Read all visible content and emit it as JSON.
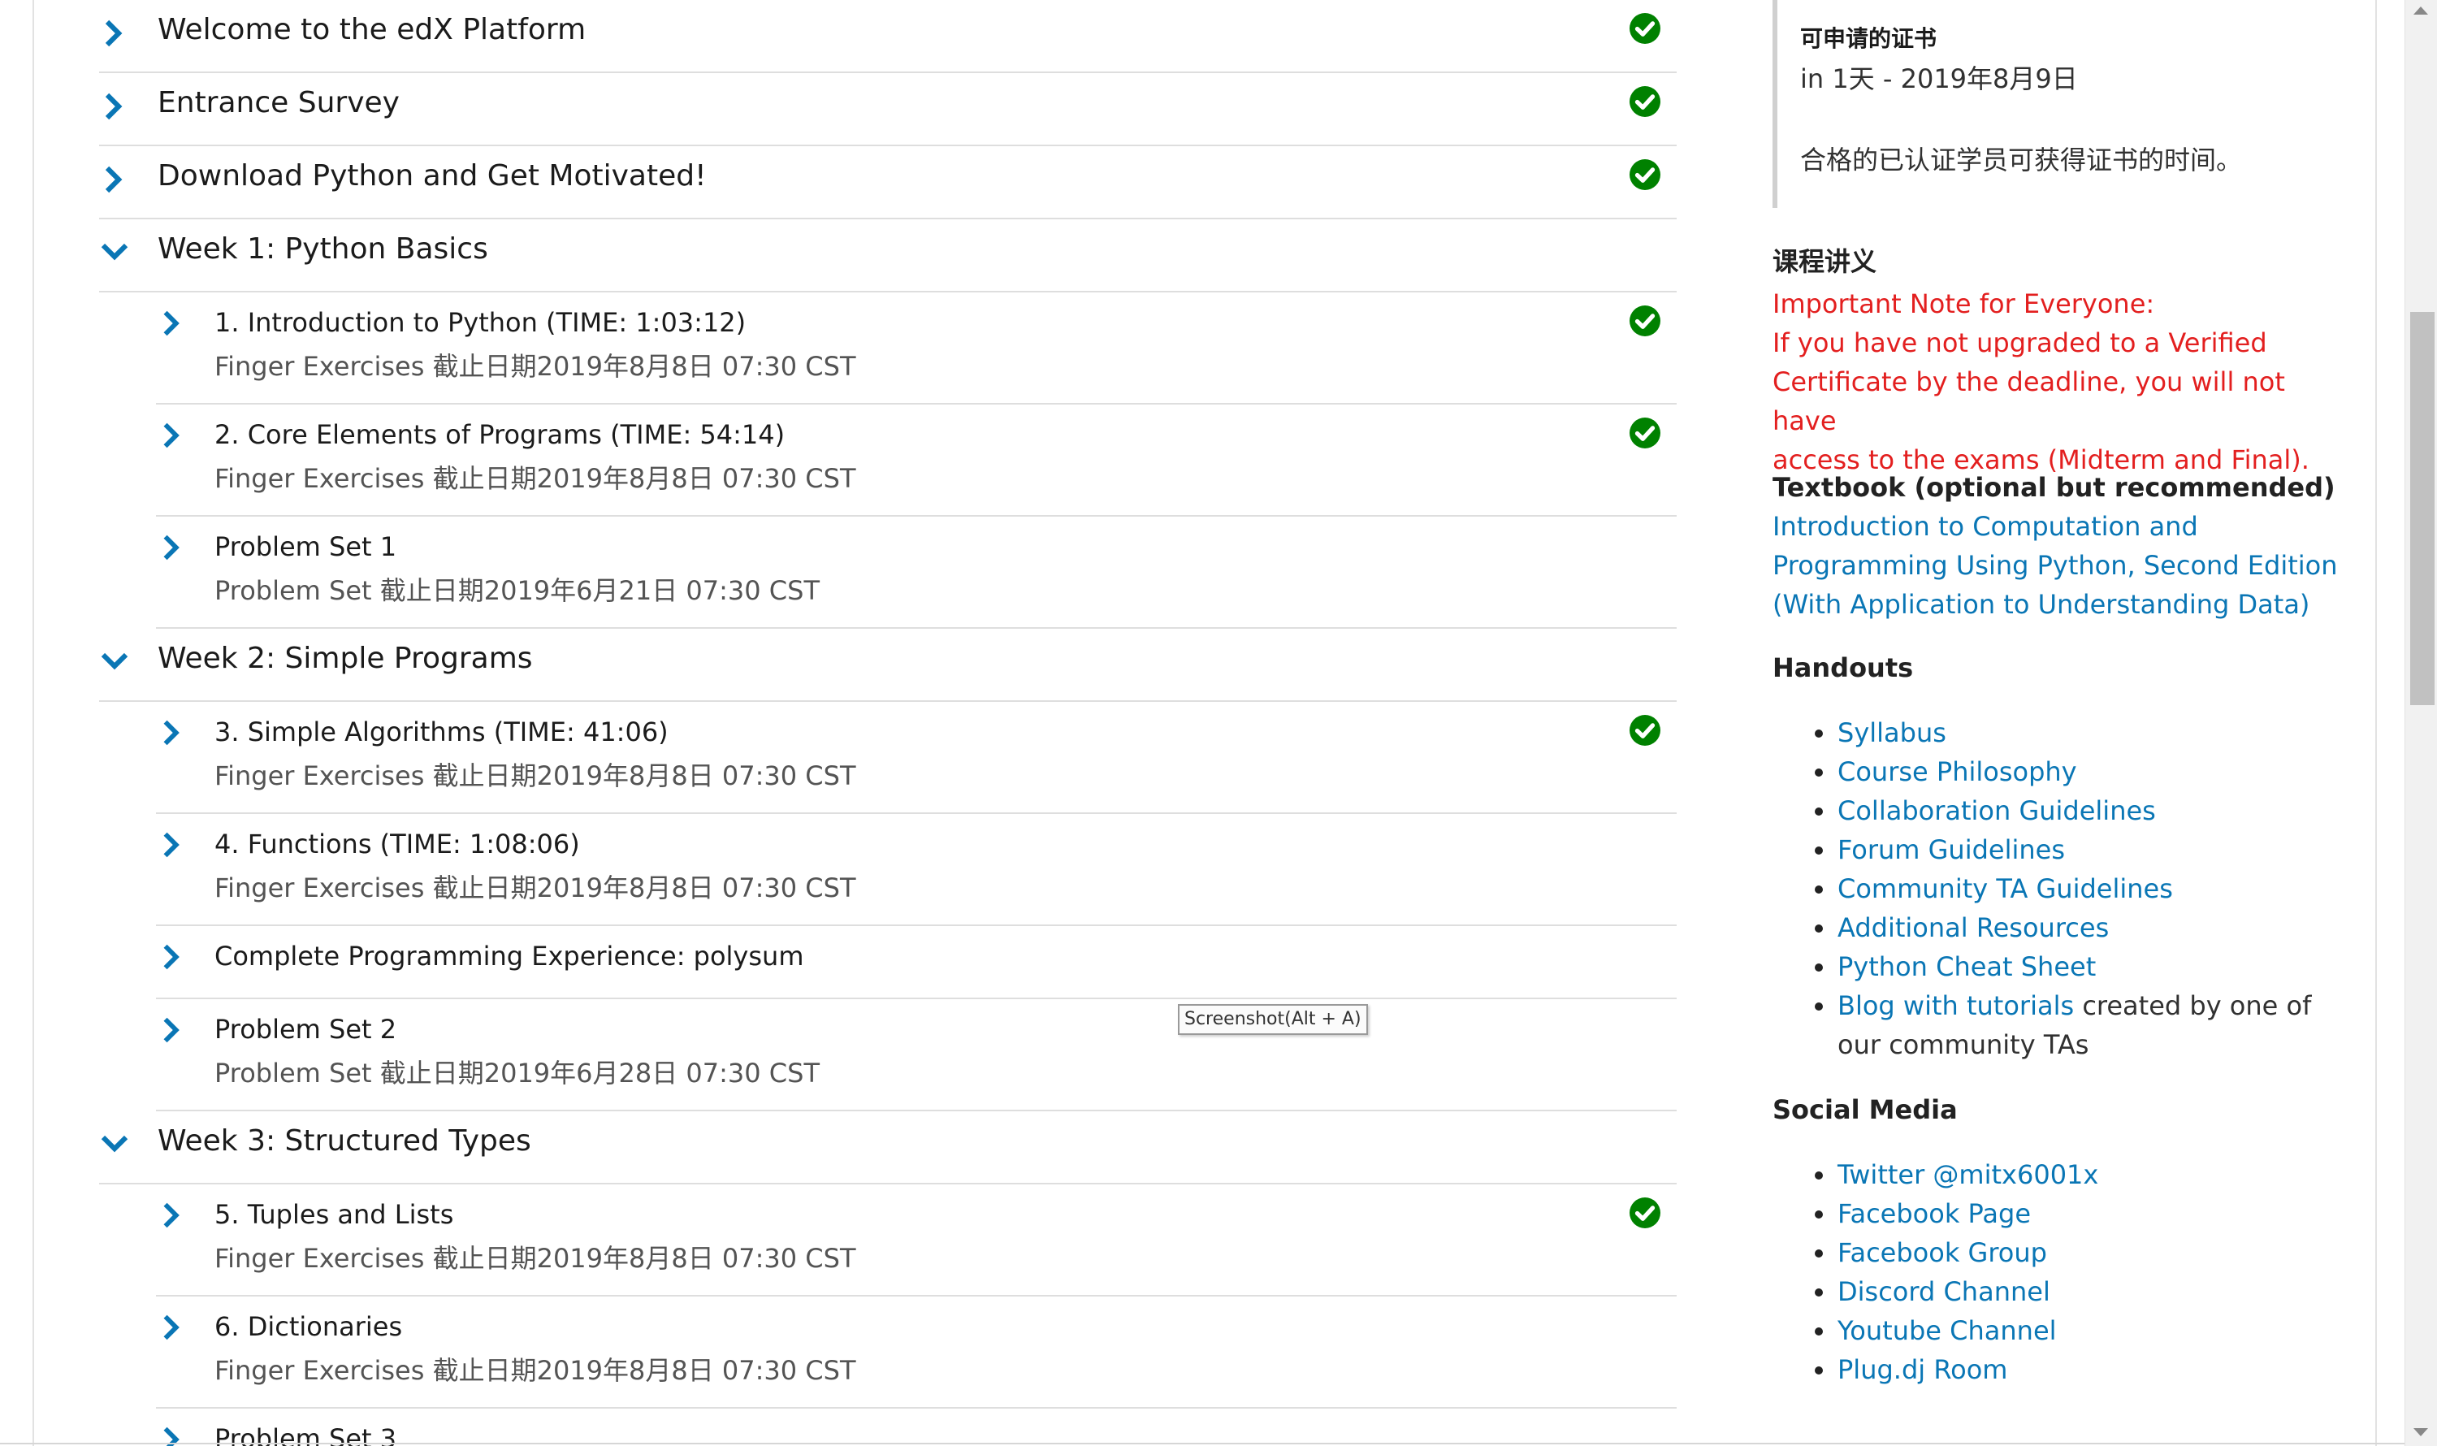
{
  "colors": {
    "link": "#0a76b5",
    "warning": "#e31f1f",
    "complete_check": "#008100",
    "chevron": "#0a76b5"
  },
  "outline": {
    "sections": [
      {
        "title": "Welcome to the edX Platform",
        "expanded": false,
        "complete": true,
        "icon": "chevron-right-icon"
      },
      {
        "title": "Entrance Survey",
        "expanded": false,
        "complete": true,
        "icon": "chevron-right-icon"
      },
      {
        "title": "Download Python and Get Motivated!",
        "expanded": false,
        "complete": true,
        "icon": "chevron-right-icon"
      },
      {
        "title": "Week 1: Python Basics",
        "expanded": true,
        "complete": false,
        "icon": "chevron-down-icon",
        "subsections": [
          {
            "title": "1. Introduction to Python (TIME: 1:03:12)",
            "meta": "Finger Exercises 截止日期2019年8月8日 07:30 CST",
            "complete": true
          },
          {
            "title": "2. Core Elements of Programs (TIME: 54:14)",
            "meta": "Finger Exercises 截止日期2019年8月8日 07:30 CST",
            "complete": true
          },
          {
            "title": "Problem Set 1",
            "meta": "Problem Set 截止日期2019年6月21日 07:30 CST",
            "complete": false
          }
        ]
      },
      {
        "title": "Week 2: Simple Programs",
        "expanded": true,
        "complete": false,
        "icon": "chevron-down-icon",
        "subsections": [
          {
            "title": "3. Simple Algorithms (TIME: 41:06)",
            "meta": "Finger Exercises 截止日期2019年8月8日 07:30 CST",
            "complete": true
          },
          {
            "title": "4. Functions (TIME: 1:08:06)",
            "meta": "Finger Exercises 截止日期2019年8月8日 07:30 CST",
            "complete": false
          },
          {
            "title": "Complete Programming Experience: polysum",
            "meta": "",
            "complete": false
          },
          {
            "title": "Problem Set 2",
            "meta": "Problem Set 截止日期2019年6月28日 07:30 CST",
            "complete": false
          }
        ]
      },
      {
        "title": "Week 3: Structured Types",
        "expanded": true,
        "complete": false,
        "icon": "chevron-down-icon",
        "subsections": [
          {
            "title": "5. Tuples and Lists",
            "meta": "Finger Exercises 截止日期2019年8月8日 07:30 CST",
            "complete": true
          },
          {
            "title": "6. Dictionaries",
            "meta": "Finger Exercises 截止日期2019年8月8日 07:30 CST",
            "complete": false
          },
          {
            "title": "Problem Set 3",
            "meta": "",
            "complete": false
          }
        ]
      }
    ]
  },
  "tooltip": "Screenshot(Alt + A)",
  "sidebar": {
    "certificate": {
      "heading": "可申请的证书",
      "date": "in 1天 - 2019年8月9日",
      "description": "合格的已认证学员可获得证书的时间。"
    },
    "handouts_title": "课程讲义",
    "note_lines": [
      "Important Note for Everyone:",
      "If you have not upgraded to a Verified",
      "Certificate by the deadline, you will not have",
      "access to the exams (Midterm and Final)."
    ],
    "textbook_heading": "Textbook (optional but recommended)",
    "textbook_lines": [
      "Introduction to Computation and",
      "Programming Using Python, Second Edition",
      "(With Application to Understanding Data)"
    ],
    "handouts_heading": "Handouts",
    "handouts": [
      "Syllabus",
      "Course Philosophy",
      "Collaboration Guidelines",
      "Forum Guidelines",
      "Community TA Guidelines",
      "Additional Resources",
      "Python Cheat Sheet"
    ],
    "blog_link": "Blog with tutorials",
    "blog_rest_line1": " created by one of",
    "blog_rest_line2": "our community TAs",
    "social_heading": "Social Media",
    "social": [
      "Twitter @mitx6001x",
      "Facebook Page",
      "Facebook Group",
      "Discord Channel",
      "Youtube Channel",
      "Plug.dj Room"
    ]
  }
}
